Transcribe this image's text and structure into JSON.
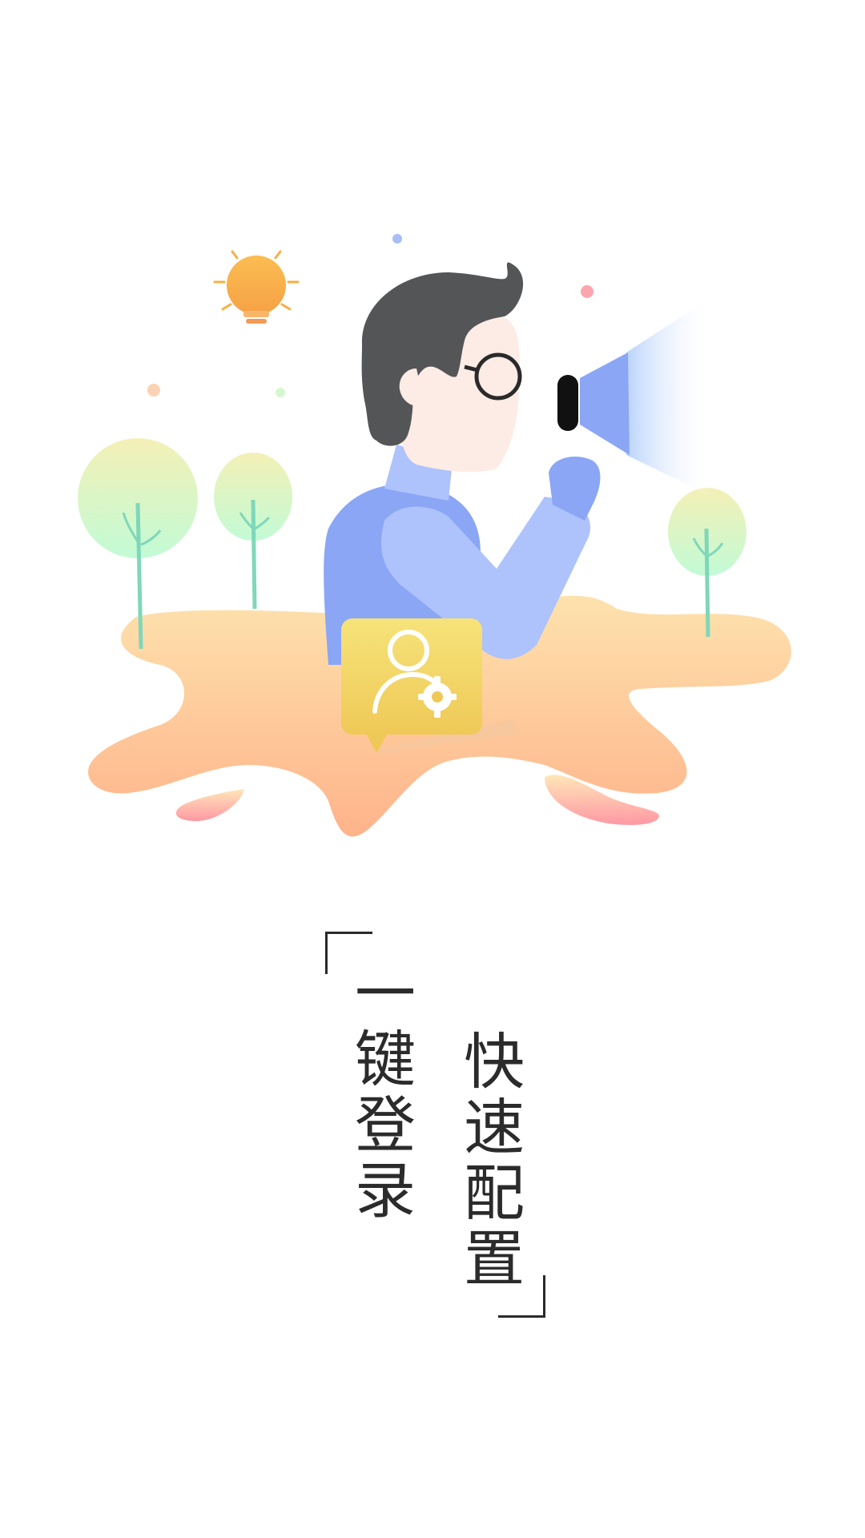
{
  "slogan": {
    "left_column": "一键登录",
    "right_column": "快速配置"
  },
  "colors": {
    "background": "#ffffff",
    "text": "#2b2b2b",
    "hair": "#545557",
    "shirt": "#8aa6f5",
    "sleeve": "#aec2fb",
    "skin": "#fdece5",
    "ground_top": "#fcdca6",
    "ground_bottom": "#ffb28a",
    "badge": "#f3d96a",
    "bulb": "#f8ab4a",
    "tree_top": "#f2f0b8",
    "tree_bottom": "#c6fbd6",
    "trunk": "#7fd7b9"
  },
  "icons": [
    "lightbulb-icon",
    "megaphone-icon",
    "user-settings-badge-icon"
  ]
}
